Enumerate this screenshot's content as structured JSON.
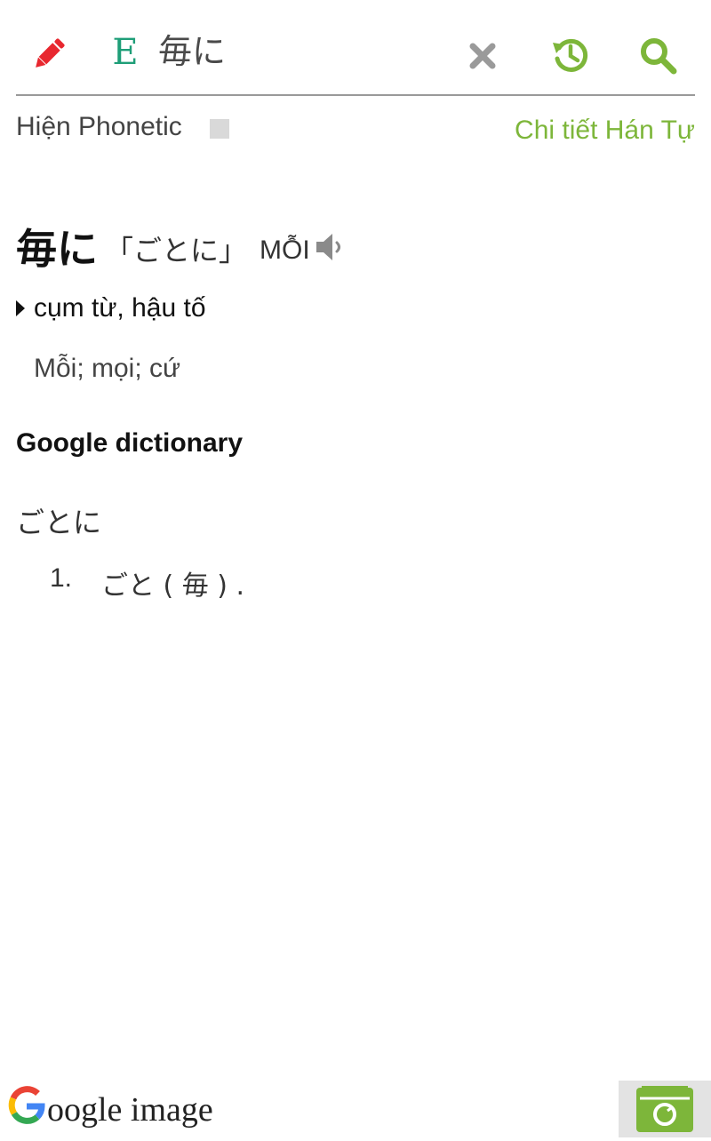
{
  "search": {
    "language_badge": "E",
    "query": "毎に"
  },
  "options": {
    "phonetic_label": "Hiện Phonetic",
    "kanji_detail_link": "Chi tiết Hán Tự"
  },
  "entry": {
    "word": "毎に",
    "reading": "「ごとに」",
    "hanviet": "MỖI",
    "part_of_speech": "cụm từ, hậu tố",
    "meaning": "Mỗi; mọi; cứ"
  },
  "google_dictionary": {
    "heading": "Google dictionary",
    "word": "ごとに",
    "items": [
      {
        "number": "1.",
        "text": "ごと ( 毎 ) ."
      }
    ]
  },
  "footer": {
    "google_image_rest": "oogle image",
    "google_image_first": "G"
  },
  "colors": {
    "accent_green": "#7db63a",
    "edit_red": "#e8272f",
    "badge_teal": "#1e9e78",
    "clear_gray": "#9a9a9a"
  },
  "icons": [
    "pencil-icon",
    "close-icon",
    "history-icon",
    "search-icon",
    "speaker-icon",
    "camera-icon"
  ]
}
